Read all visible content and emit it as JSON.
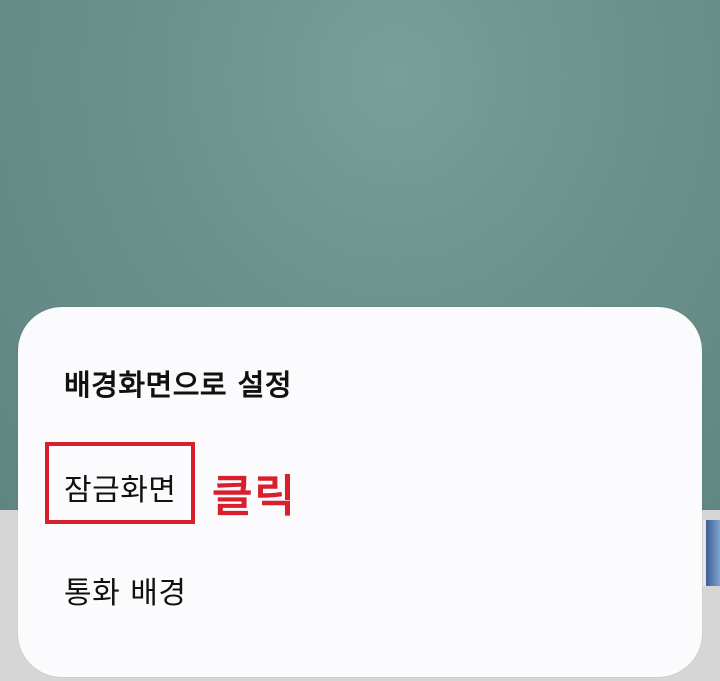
{
  "sheet": {
    "title": "배경화면으로 설정",
    "options": [
      {
        "label": "잠금화면"
      },
      {
        "label": "통화 배경"
      }
    ]
  },
  "annotation": {
    "label": "클릭",
    "color": "#d81f2c"
  }
}
